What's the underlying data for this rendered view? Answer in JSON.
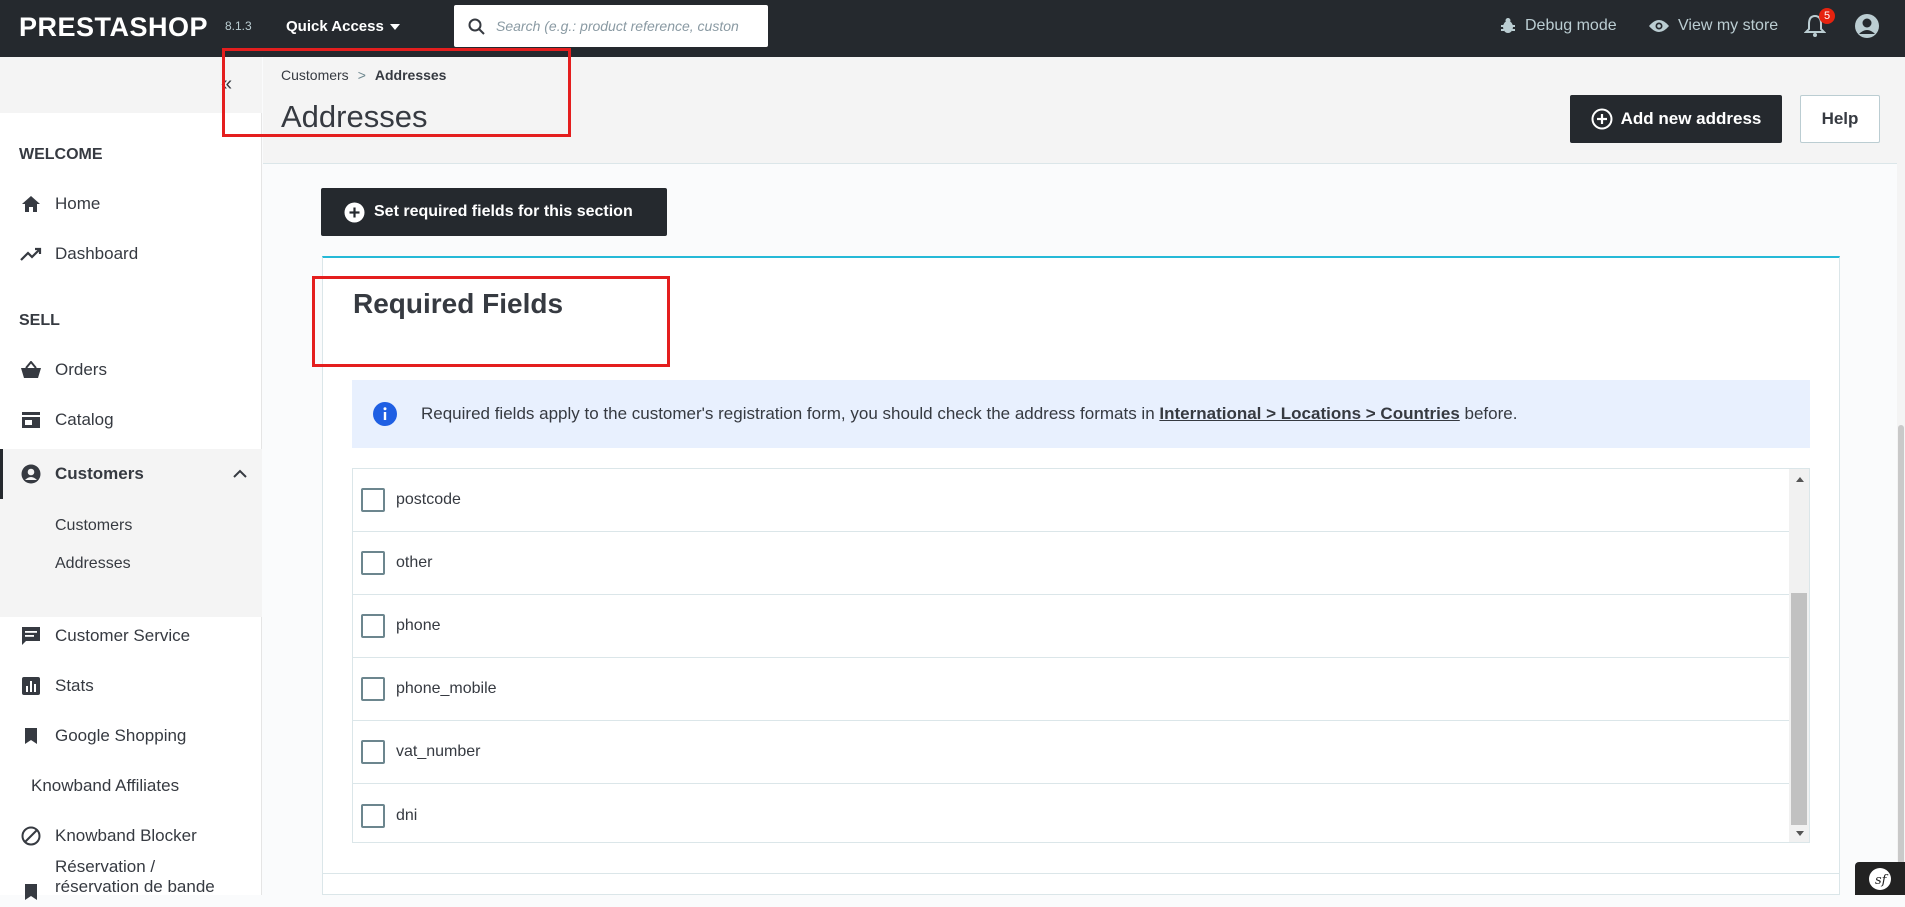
{
  "topbar": {
    "logo": "PRESTASHOP",
    "version": "8.1.3",
    "quick_access": "Quick Access",
    "search_placeholder": "Search (e.g.: product reference, custon",
    "debug_mode": "Debug mode",
    "view_store": "View my store",
    "notification_count": "5"
  },
  "sidebar": {
    "welcome_title": "WELCOME",
    "sell_title": "SELL",
    "items": {
      "home": "Home",
      "dashboard": "Dashboard",
      "orders": "Orders",
      "catalog": "Catalog",
      "customers": "Customers",
      "customers_sub": "Customers",
      "addresses_sub": "Addresses",
      "customer_service": "Customer Service",
      "stats": "Stats",
      "google_shopping": "Google Shopping",
      "knowband_affiliates": "Knowband Affiliates",
      "knowband_blocker": "Knowband Blocker",
      "reservation_line1": "Réservation /",
      "reservation_line2": "réservation de bande"
    },
    "collapse_glyph": "«"
  },
  "header": {
    "breadcrumb_parent": "Customers",
    "breadcrumb_sep": ">",
    "breadcrumb_current": "Addresses",
    "title": "Addresses",
    "add_button": "Add new address",
    "help_button": "Help"
  },
  "content": {
    "set_required_button": "Set required fields for this section",
    "card_title": "Required Fields",
    "alert_text_before": "Required fields apply to the customer's registration form, you should check the address formats in ",
    "alert_link": "International > Locations > Countries",
    "alert_text_after": " before.",
    "fields": [
      "postcode",
      "other",
      "phone",
      "phone_mobile",
      "vat_number",
      "dni"
    ]
  },
  "colors": {
    "topbar_bg": "#25292e",
    "accent": "#25b9d7",
    "highlight_box": "#e41e1e",
    "alert_bg": "#e8f0fe",
    "info_icon": "#1f5fe3"
  }
}
